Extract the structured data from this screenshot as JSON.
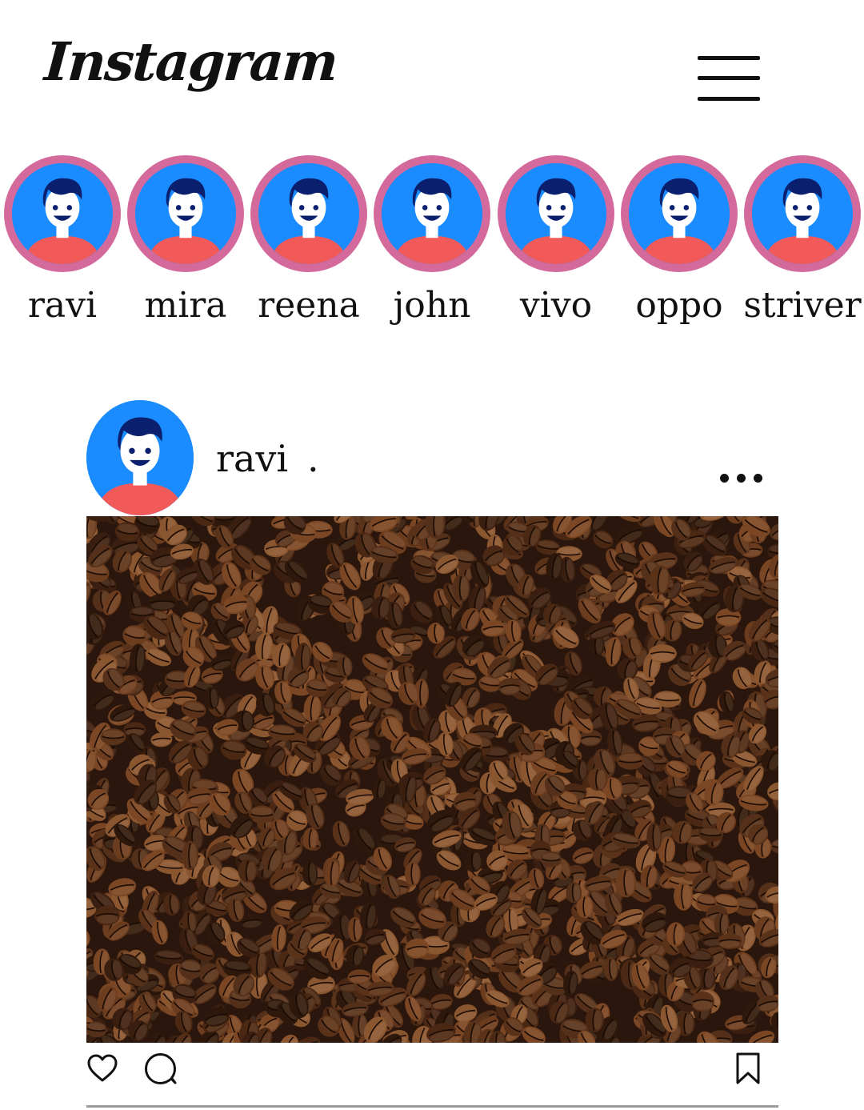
{
  "header": {
    "logo_text": "Instagram",
    "menu_icon": "hamburger-menu-icon"
  },
  "stories": [
    {
      "name": "ravi"
    },
    {
      "name": "mira"
    },
    {
      "name": "reena"
    },
    {
      "name": "john"
    },
    {
      "name": "vivo"
    },
    {
      "name": "oppo"
    },
    {
      "name": "striver"
    }
  ],
  "post": {
    "username": "ravi",
    "separator": ".",
    "image_subject": "coffee beans",
    "actions": {
      "like_icon": "heart-icon",
      "comment_icon": "comment-bubble-icon",
      "save_icon": "bookmark-icon",
      "more_icon": "more-options-icon"
    }
  },
  "colors": {
    "story_ring": "#d46a9c",
    "avatar_bg": "#1a8cff",
    "avatar_hair": "#0a1f6e",
    "avatar_shirt": "#f25a5a",
    "bean_dark": "#2a160c",
    "bean_light": "#8a5630"
  }
}
